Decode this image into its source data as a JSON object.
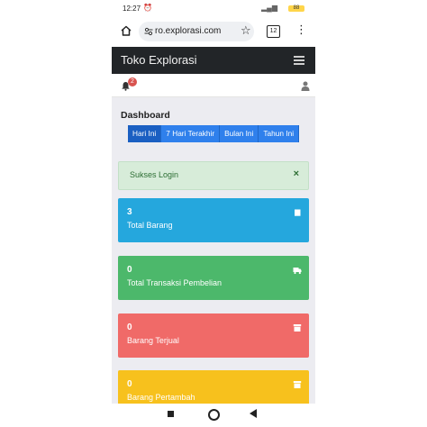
{
  "status_bar": {
    "time": "12:27",
    "battery": "88"
  },
  "browser": {
    "url": "ro.explorasi.com",
    "tab_count": "12"
  },
  "navbar": {
    "brand": "Toko Explorasi"
  },
  "notifications": {
    "count": "2"
  },
  "dashboard": {
    "title": "Dashboard",
    "filters": [
      "Hari Ini",
      "7 Hari Terakhir",
      "Bulan Ini",
      "Tahun Ini"
    ],
    "active_filter": "Hari Ini"
  },
  "alert": {
    "message": "Sukses Login",
    "close": "×"
  },
  "cards": [
    {
      "value": "3",
      "label": "Total Barang",
      "color": "#25a7dd",
      "icon": "book-icon"
    },
    {
      "value": "0",
      "label": "Total Transaksi Pembelian",
      "color": "#4cb86b",
      "icon": "truck-icon"
    },
    {
      "value": "0",
      "label": "Barang Terjual",
      "color": "#f06a68",
      "icon": "box-icon"
    },
    {
      "value": "0",
      "label": "Barang Pertambah",
      "color": "#f7c11d",
      "icon": "box-icon"
    }
  ]
}
